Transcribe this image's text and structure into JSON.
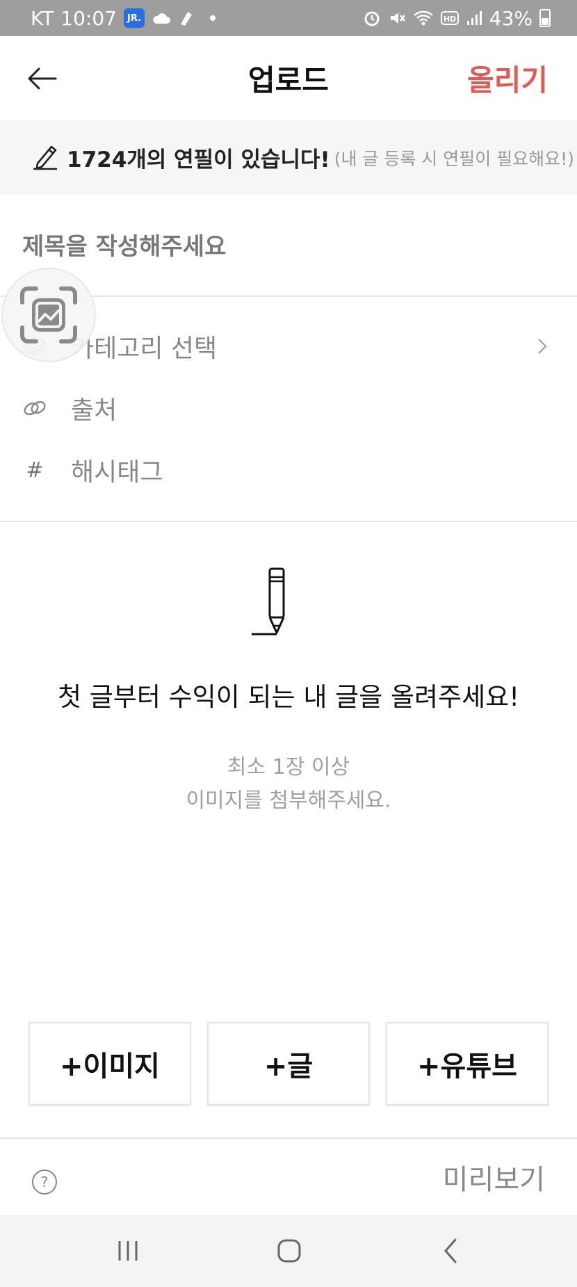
{
  "status_bar": {
    "carrier": "KT",
    "time": "10:07",
    "app_badge": "JR.",
    "battery": "43%"
  },
  "header": {
    "title": "업로드",
    "post_label": "올리기"
  },
  "banner": {
    "main_text": "1724개의 연필이 있습니다!",
    "sub_text": "(내 글 등록 시 연필이 필요해요!)"
  },
  "form": {
    "title_placeholder": "제목을 작성해주세요",
    "category_label": "카테고리 선택",
    "source_label": "출처",
    "hashtag_label": "해시태그",
    "hashtag_icon": "#"
  },
  "empty_state": {
    "headline": "첫 글부터 수익이 되는 내 글을 올려주세요!",
    "hint_line1": "최소 1장 이상",
    "hint_line2": "이미지를 첨부해주세요."
  },
  "add_buttons": {
    "image": "+이미지",
    "text": "+글",
    "youtube": "+유튜브"
  },
  "footer": {
    "help_symbol": "?",
    "preview_label": "미리보기"
  },
  "colors": {
    "accent": "#e25a55",
    "status_bar": "#9e9e9e",
    "banner_bg": "#f6f6f6"
  },
  "icons": [
    "back-arrow-icon",
    "pencil-icon",
    "scan-icon",
    "layers-icon",
    "link-icon",
    "hash-icon",
    "chevron-right-icon",
    "help-icon"
  ]
}
